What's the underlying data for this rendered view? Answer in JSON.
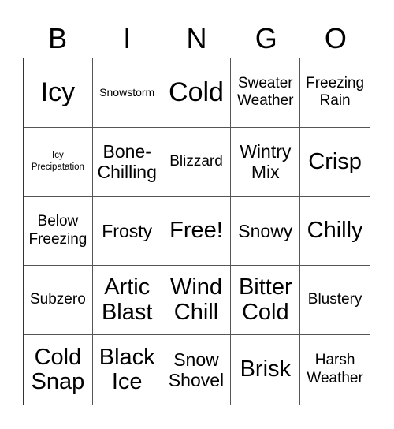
{
  "header": {
    "letters": [
      "B",
      "I",
      "N",
      "G",
      "O"
    ]
  },
  "cells": [
    "Icy",
    "Snowstorm",
    "Cold",
    "Sweater Weather",
    "Freezing Rain",
    "Icy Precipatation",
    "Bone-Chilling",
    "Blizzard",
    "Wintry Mix",
    "Crisp",
    "Below Freezing",
    "Frosty",
    "Free!",
    "Snowy",
    "Chilly",
    "Subzero",
    "Artic Blast",
    "Wind Chill",
    "Bitter Cold",
    "Blustery",
    "Cold Snap",
    "Black Ice",
    "Snow Shovel",
    "Brisk",
    "Harsh Weather"
  ]
}
